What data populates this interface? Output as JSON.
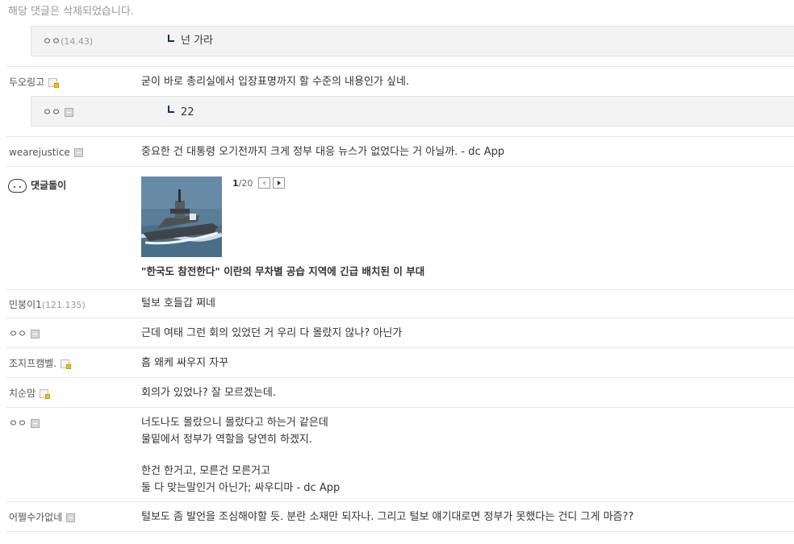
{
  "deleted_notice": "해당 댓글은 삭제되었습니다.",
  "comments": [
    {
      "nick": "ㅇㅇ",
      "ip": "(14.43)",
      "text": "넌 가라"
    },
    {
      "nick": "두오링고",
      "text": "굳이 바로 총리실에서 입장표명까지 할 수준의 내용인가 싶네."
    },
    {
      "nick": "ㅇㅇ",
      "text": "22"
    },
    {
      "nick": "wearejustice",
      "text": "중요한 건 대통령 오기전까지 크게 정부 대응 뉴스가 없었다는 거 아닐까. - dc App"
    },
    {
      "nick": "민붕이1",
      "ip": "(121.135)",
      "text": "털보 호들갑 쩌네"
    },
    {
      "nick": "ㅇㅇ",
      "text": "근데 여태 그런 회의 있었던 거 우리 다 몰랐지 않나? 아닌가"
    },
    {
      "nick": "조지프캠벨.",
      "text": "흠 왜케 싸우지 자꾸"
    },
    {
      "nick": "치순맘",
      "text": "회의가 있었나? 잘 모르겠는데."
    },
    {
      "nick": "ㅇㅇ",
      "lines": [
        "너도나도 몰랐으니 몰랐다고 하는거 같은데",
        "물밑에서 정부가 역할을 당연히 하겠지.",
        "",
        "한건 한거고, 모른건 모른거고",
        "둘 다 맞는말인거 아닌가; 싸우디마 - dc App"
      ]
    },
    {
      "nick": "어쩔수가없네",
      "text": "털보도 좀 발언을 조심해야할 듯. 분란 소재만 되자나. 그리고 털보 얘기대로면 정부가 못했다는 건디 그게 마즘??"
    }
  ],
  "ad": {
    "bot_name": "댓글돌이",
    "page_current": "1",
    "page_total": "/20",
    "headline": "\"한국도 참전한다\" 이란의 무차별 공습 지역에 긴급 배치된 이 부대",
    "bot_icon": "smiley-face-icon",
    "thumb_icon": "warship-photo"
  },
  "colors": {
    "reply_bg": "#f3f3f3",
    "divider": "#e6e6e6",
    "arrow": "#1d2b6b",
    "fixed_badge": "#f0c010"
  }
}
